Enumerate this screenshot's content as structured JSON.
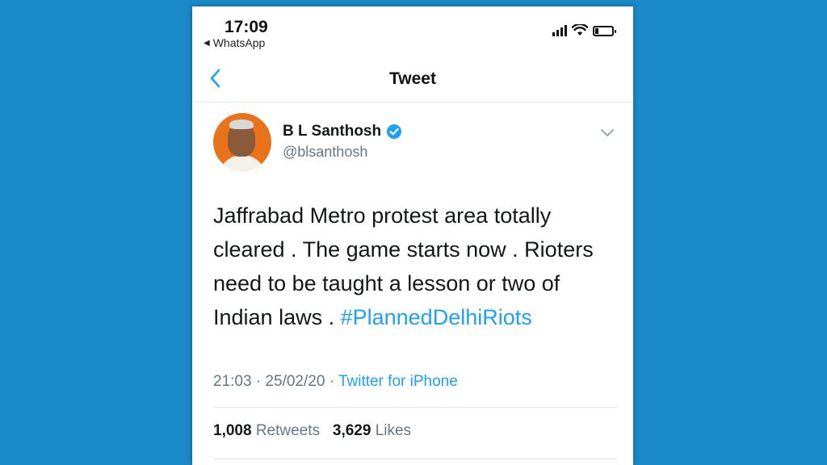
{
  "status_bar": {
    "time": "17:09",
    "back_app": "WhatsApp",
    "back_icon": "left-triangle-icon",
    "icons": [
      "cellular-signal-icon",
      "wifi-icon",
      "battery-icon"
    ]
  },
  "nav": {
    "title": "Tweet",
    "back_icon": "chevron-left-icon"
  },
  "tweet": {
    "author_name": "B L Santhosh",
    "author_handle": "@blsanthosh",
    "verified_icon": "verified-badge-icon",
    "text": "Jaffrabad Metro protest area totally cleared . The game starts now . Rioters need to be taught a lesson or two of Indian laws . ",
    "hashtag": "#PlannedDelhiRiots",
    "timestamp": "21:03 · 25/02/20 · ",
    "source": "Twitter for iPhone",
    "retweets_count": "1,008",
    "retweets_label": "Retweets",
    "likes_count": "3,629",
    "likes_label": "Likes"
  },
  "colors": {
    "background": "#1a8ac8",
    "accent": "#1da1f2",
    "secondary_text": "#657786"
  }
}
